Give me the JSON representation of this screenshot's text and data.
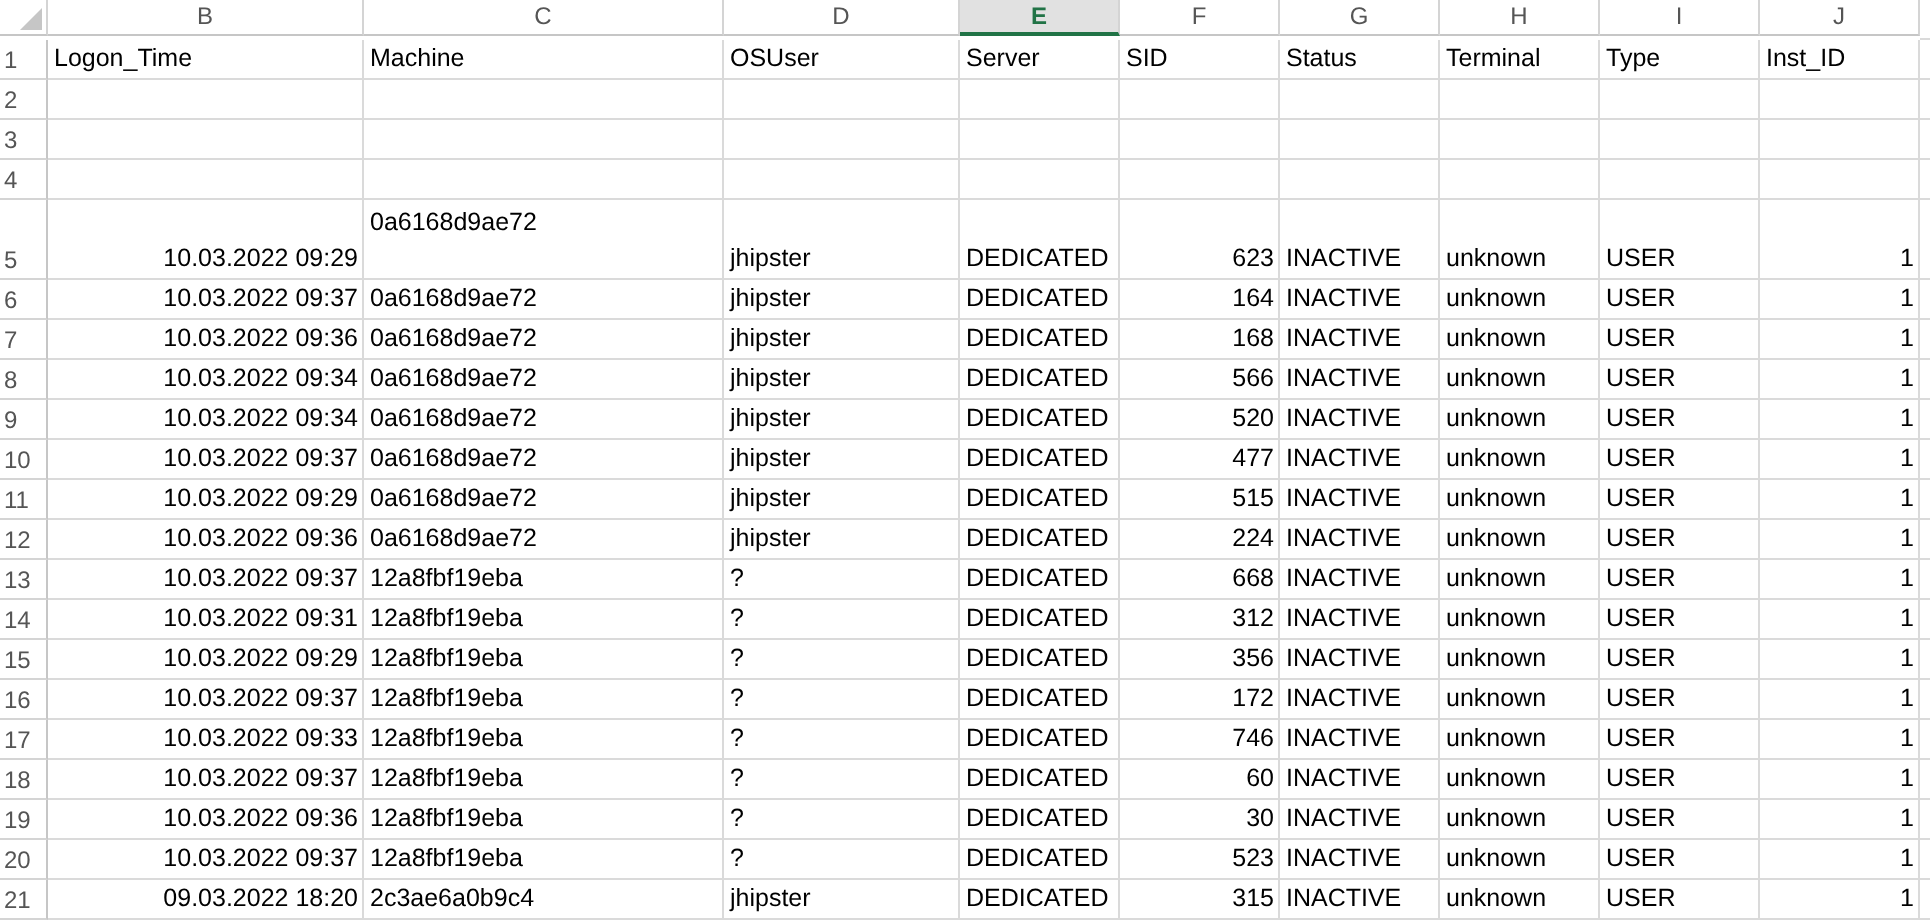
{
  "columns": [
    {
      "letter": "B",
      "numeric": true,
      "selected": false
    },
    {
      "letter": "C",
      "numeric": false,
      "selected": false
    },
    {
      "letter": "D",
      "numeric": false,
      "selected": false
    },
    {
      "letter": "E",
      "numeric": false,
      "selected": true
    },
    {
      "letter": "F",
      "numeric": true,
      "selected": false
    },
    {
      "letter": "G",
      "numeric": false,
      "selected": false
    },
    {
      "letter": "H",
      "numeric": false,
      "selected": false
    },
    {
      "letter": "I",
      "numeric": false,
      "selected": false
    },
    {
      "letter": "J",
      "numeric": true,
      "selected": false
    }
  ],
  "rows": [
    {
      "number": "1",
      "header": true,
      "cells": [
        "Logon_Time",
        "Machine",
        "OSUser",
        "Server",
        "SID",
        "Status",
        "Terminal",
        "Type",
        "Inst_ID"
      ]
    },
    {
      "number": "2"
    },
    {
      "number": "3"
    },
    {
      "number": "4"
    },
    {
      "number": "5",
      "wrapped": true,
      "cells": [
        "10.03.2022 09:29",
        "0a6168d9ae72",
        "jhipster",
        "DEDICATED",
        "623",
        "INACTIVE",
        "unknown",
        "USER",
        "1"
      ]
    },
    {
      "number": "6",
      "cells": [
        "10.03.2022 09:37",
        "0a6168d9ae72",
        "jhipster",
        "DEDICATED",
        "164",
        "INACTIVE",
        "unknown",
        "USER",
        "1"
      ]
    },
    {
      "number": "7",
      "cells": [
        "10.03.2022 09:36",
        "0a6168d9ae72",
        "jhipster",
        "DEDICATED",
        "168",
        "INACTIVE",
        "unknown",
        "USER",
        "1"
      ]
    },
    {
      "number": "8",
      "cells": [
        "10.03.2022 09:34",
        "0a6168d9ae72",
        "jhipster",
        "DEDICATED",
        "566",
        "INACTIVE",
        "unknown",
        "USER",
        "1"
      ]
    },
    {
      "number": "9",
      "cells": [
        "10.03.2022 09:34",
        "0a6168d9ae72",
        "jhipster",
        "DEDICATED",
        "520",
        "INACTIVE",
        "unknown",
        "USER",
        "1"
      ]
    },
    {
      "number": "10",
      "cells": [
        "10.03.2022 09:37",
        "0a6168d9ae72",
        "jhipster",
        "DEDICATED",
        "477",
        "INACTIVE",
        "unknown",
        "USER",
        "1"
      ]
    },
    {
      "number": "11",
      "cells": [
        "10.03.2022 09:29",
        "0a6168d9ae72",
        "jhipster",
        "DEDICATED",
        "515",
        "INACTIVE",
        "unknown",
        "USER",
        "1"
      ]
    },
    {
      "number": "12",
      "cells": [
        "10.03.2022 09:36",
        "0a6168d9ae72",
        "jhipster",
        "DEDICATED",
        "224",
        "INACTIVE",
        "unknown",
        "USER",
        "1"
      ]
    },
    {
      "number": "13",
      "cells": [
        "10.03.2022 09:37",
        "12a8fbf19eba",
        "?",
        "DEDICATED",
        "668",
        "INACTIVE",
        "unknown",
        "USER",
        "1"
      ]
    },
    {
      "number": "14",
      "cells": [
        "10.03.2022 09:31",
        "12a8fbf19eba",
        "?",
        "DEDICATED",
        "312",
        "INACTIVE",
        "unknown",
        "USER",
        "1"
      ]
    },
    {
      "number": "15",
      "cells": [
        "10.03.2022 09:29",
        "12a8fbf19eba",
        "?",
        "DEDICATED",
        "356",
        "INACTIVE",
        "unknown",
        "USER",
        "1"
      ]
    },
    {
      "number": "16",
      "cells": [
        "10.03.2022 09:37",
        "12a8fbf19eba",
        "?",
        "DEDICATED",
        "172",
        "INACTIVE",
        "unknown",
        "USER",
        "1"
      ]
    },
    {
      "number": "17",
      "cells": [
        "10.03.2022 09:33",
        "12a8fbf19eba",
        "?",
        "DEDICATED",
        "746",
        "INACTIVE",
        "unknown",
        "USER",
        "1"
      ]
    },
    {
      "number": "18",
      "cells": [
        "10.03.2022 09:37",
        "12a8fbf19eba",
        "?",
        "DEDICATED",
        "60",
        "INACTIVE",
        "unknown",
        "USER",
        "1"
      ]
    },
    {
      "number": "19",
      "cells": [
        "10.03.2022 09:36",
        "12a8fbf19eba",
        "?",
        "DEDICATED",
        "30",
        "INACTIVE",
        "unknown",
        "USER",
        "1"
      ]
    },
    {
      "number": "20",
      "cells": [
        "10.03.2022 09:37",
        "12a8fbf19eba",
        "?",
        "DEDICATED",
        "523",
        "INACTIVE",
        "unknown",
        "USER",
        "1"
      ]
    },
    {
      "number": "21",
      "cells": [
        "09.03.2022 18:20",
        "2c3ae6a0b9c4",
        "jhipster",
        "DEDICATED",
        "315",
        "INACTIVE",
        "unknown",
        "USER",
        "1"
      ]
    }
  ]
}
